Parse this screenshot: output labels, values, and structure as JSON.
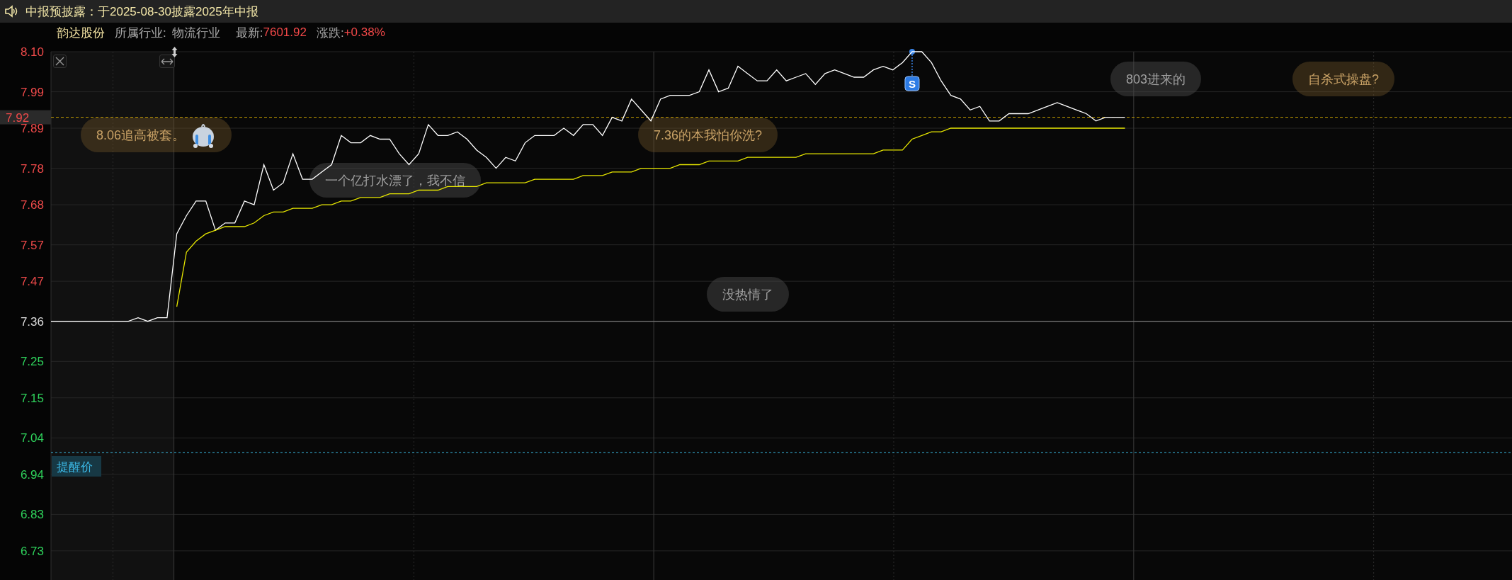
{
  "notice_bar": {
    "text": "中报预披露：于2025-08-30披露2025年中报"
  },
  "stock_info": {
    "name": "韵达股份",
    "industry_label": "所属行业:",
    "industry": "物流行业",
    "latest_label": "最新:",
    "latest": "7601.92",
    "change_label": "涨跌:",
    "change": "+0.38%"
  },
  "chart": {
    "chart_data": {
      "type": "line",
      "ylim": [
        6.65,
        8.1
      ],
      "grid": true,
      "yticks": [
        {
          "value": 8.1,
          "label": "8.10"
        },
        {
          "value": 7.99,
          "label": "7.99"
        },
        {
          "value": 7.89,
          "label": "7.89"
        },
        {
          "value": 7.78,
          "label": "7.78"
        },
        {
          "value": 7.68,
          "label": "7.68"
        },
        {
          "value": 7.57,
          "label": "7.57"
        },
        {
          "value": 7.47,
          "label": "7.47"
        },
        {
          "value": 7.36,
          "label": "7.36"
        },
        {
          "value": 7.25,
          "label": "7.25"
        },
        {
          "value": 7.15,
          "label": "7.15"
        },
        {
          "value": 7.04,
          "label": "7.04"
        },
        {
          "value": 6.94,
          "label": "6.94"
        },
        {
          "value": 6.83,
          "label": "6.83"
        },
        {
          "value": 6.73,
          "label": "6.73"
        }
      ],
      "series": [
        {
          "color": "#ffffff",
          "values": [
            7.36,
            7.36,
            7.36,
            7.36,
            7.36,
            7.36,
            7.36,
            7.36,
            7.36,
            7.37,
            7.36,
            7.37,
            7.37,
            7.6,
            7.65,
            7.69,
            7.69,
            7.61,
            7.63,
            7.63,
            7.69,
            7.68,
            7.79,
            7.72,
            7.74,
            7.82,
            7.75,
            7.75,
            7.77,
            7.79,
            7.87,
            7.85,
            7.85,
            7.87,
            7.86,
            7.86,
            7.82,
            7.79,
            7.82,
            7.9,
            7.87,
            7.87,
            7.88,
            7.86,
            7.83,
            7.81,
            7.78,
            7.81,
            7.8,
            7.85,
            7.87,
            7.87,
            7.87,
            7.89,
            7.87,
            7.9,
            7.9,
            7.87,
            7.92,
            7.91,
            7.97,
            7.94,
            7.91,
            7.97,
            7.98,
            7.98,
            7.98,
            7.99,
            8.05,
            7.99,
            8.0,
            8.06,
            8.04,
            8.02,
            8.02,
            8.05,
            8.02,
            8.03,
            8.04,
            8.01,
            8.04,
            8.05,
            8.04,
            8.03,
            8.03,
            8.05,
            8.06,
            8.05,
            8.07,
            8.1,
            8.1,
            8.07,
            8.02,
            7.98,
            7.97,
            7.94,
            7.95,
            7.91,
            7.91,
            7.93,
            7.93,
            7.93,
            7.94,
            7.95,
            7.96,
            7.95,
            7.94,
            7.93,
            7.91,
            7.92,
            7.92,
            7.92
          ]
        },
        {
          "color": "#e6e600",
          "values": [
            null,
            null,
            null,
            null,
            null,
            null,
            null,
            null,
            null,
            null,
            null,
            null,
            null,
            7.4,
            7.55,
            7.58,
            7.6,
            7.61,
            7.62,
            7.62,
            7.62,
            7.63,
            7.65,
            7.66,
            7.66,
            7.67,
            7.67,
            7.67,
            7.68,
            7.68,
            7.69,
            7.69,
            7.7,
            7.7,
            7.7,
            7.71,
            7.71,
            7.71,
            7.72,
            7.72,
            7.72,
            7.73,
            7.73,
            7.73,
            7.73,
            7.74,
            7.74,
            7.74,
            7.74,
            7.74,
            7.75,
            7.75,
            7.75,
            7.75,
            7.75,
            7.76,
            7.76,
            7.76,
            7.77,
            7.77,
            7.77,
            7.78,
            7.78,
            7.78,
            7.78,
            7.79,
            7.79,
            7.79,
            7.8,
            7.8,
            7.8,
            7.8,
            7.81,
            7.81,
            7.81,
            7.81,
            7.81,
            7.81,
            7.82,
            7.82,
            7.82,
            7.82,
            7.82,
            7.82,
            7.82,
            7.82,
            7.83,
            7.83,
            7.83,
            7.86,
            7.87,
            7.88,
            7.88,
            7.89,
            7.89,
            7.89,
            7.89,
            7.89,
            7.89,
            7.89,
            7.89,
            7.89,
            7.89,
            7.89,
            7.89,
            7.89,
            7.89,
            7.89,
            7.89,
            7.89,
            7.89,
            7.89
          ]
        }
      ],
      "ref_lines": [
        {
          "axis": "y",
          "value": 7.36,
          "color": "#6a6a6a"
        },
        {
          "axis": "y",
          "value": 7.92,
          "label": "7.92",
          "color": "#c8a000"
        },
        {
          "axis": "y",
          "value": 7.0,
          "label": "提醒价",
          "color": "#3ab8e0"
        }
      ],
      "annotations": [
        {
          "text": "S"
        }
      ]
    }
  },
  "comments": [
    {
      "text": "8.06追高被套。",
      "kind": "highlight",
      "emoji": true
    },
    {
      "text": "一个亿打水漂了，我不信",
      "kind": "plain",
      "emoji": false
    },
    {
      "text": "7.36的本我怕你洗?",
      "kind": "highlight",
      "emoji": false
    },
    {
      "text": "没热情了",
      "kind": "plain",
      "emoji": false
    },
    {
      "text": "803进来的",
      "kind": "plain",
      "emoji": false
    },
    {
      "text": "自杀式操盘?",
      "kind": "highlight",
      "emoji": false
    }
  ]
}
